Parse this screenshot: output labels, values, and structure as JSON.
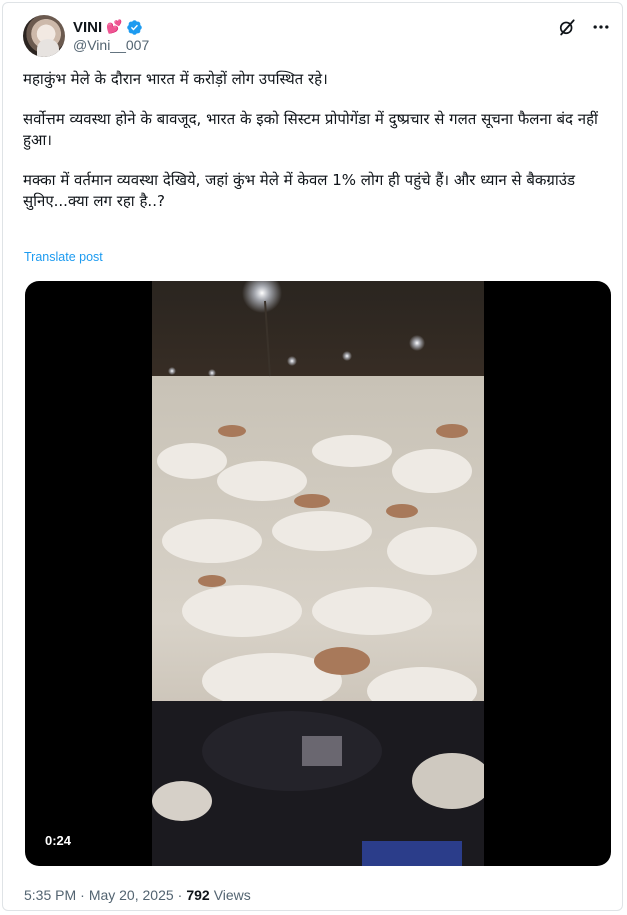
{
  "author": {
    "display_name": "VINI",
    "name_emoji": "💕",
    "handle": "@Vini__007",
    "verified": true
  },
  "post": {
    "paragraphs": [
      "महाकुंभ मेले के दौरान भारत में करोड़ों लोग उपस्थित रहे।",
      "सर्वोत्तम व्यवस्था होने के बावजूद, भारत के इको सिस्टम प्रोपोगेंडा में दुष्प्रचार से गलत सूचना फैलना बंद नहीं हुआ।",
      "मक्का में वर्तमान व्यवस्था देखिये, जहां कुंभ मेले में केवल 1% लोग ही पहुंचे हैं। और ध्यान से बैकग्राउंड सुनिए...क्या लग रहा है..?"
    ],
    "translate_label": "Translate post"
  },
  "media": {
    "type": "video",
    "duration": "0:24"
  },
  "footer": {
    "time": "5:35 PM",
    "separator": "·",
    "date": "May 20, 2025",
    "views_count": "792",
    "views_label": "Views"
  },
  "icons": {
    "verified": "verified-badge-icon",
    "grok": "grok-icon",
    "more": "more-icon"
  },
  "colors": {
    "link": "#1d9bf0",
    "secondary_text": "#536471",
    "verified": "#1d9bf0"
  }
}
